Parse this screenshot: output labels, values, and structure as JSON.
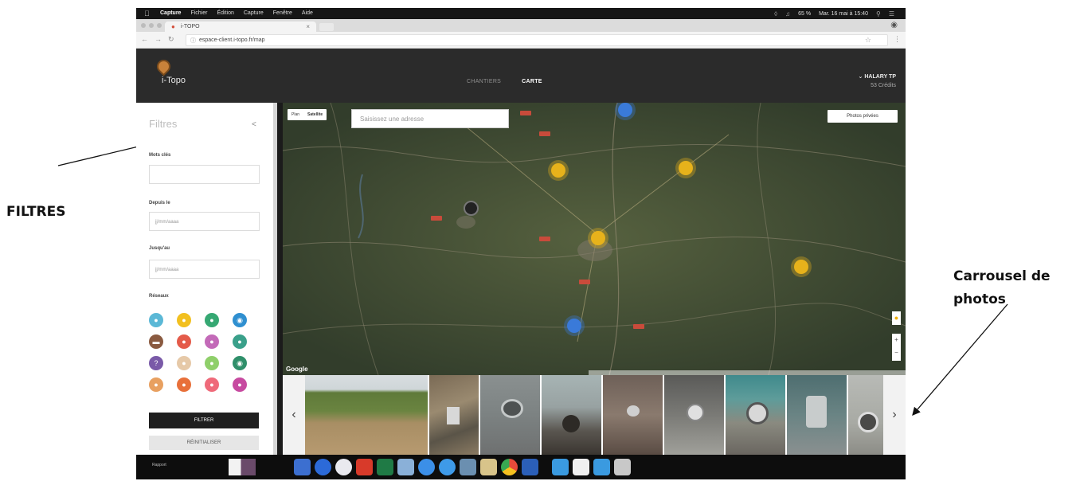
{
  "annotations": {
    "filters_label": "FILTRES",
    "carousel_label_line1": "Carrousel de",
    "carousel_label_line2": "photos"
  },
  "menubar": {
    "app_name": "Capture",
    "menus": [
      "Fichier",
      "Édition",
      "Capture",
      "Fenêtre",
      "Aide"
    ],
    "battery": "65 %",
    "datetime": "Mar. 16 mai à 15:40"
  },
  "browser": {
    "tab_title": "i-TOPO",
    "url": "espace-client.i-topo.fr/map"
  },
  "app": {
    "logo_text": "i-Topo",
    "nav": {
      "chantiers": "CHANTIERS",
      "carte": "CARTE"
    },
    "user": {
      "name": "HALARY TP",
      "credits": "53 Crédits"
    }
  },
  "sidebar": {
    "title": "Filtres",
    "collapse": "<",
    "keywords_label": "Mots clés",
    "keywords_value": "",
    "since_label": "Depuis le",
    "since_placeholder": "jj/mm/aaaa",
    "until_label": "Jusqu'au",
    "until_placeholder": "jj/mm/aaaa",
    "networks_label": "Réseaux",
    "filter_button": "FILTRER",
    "reset_button": "RÉINITIALISER",
    "network_colors": [
      "#5bb8d6",
      "#f2c020",
      "#36a873",
      "#2f8fd0",
      "#8a5a40",
      "#e45b4a",
      "#c36ab8",
      "#3aa08a",
      "#7a5aa8",
      "#e6c9a8",
      "#8fcf6a",
      "#2f8f6a",
      "#e8a060",
      "#e8703a",
      "#ef6a7a",
      "#c74aa0"
    ],
    "network_icons": [
      "droplet-icon",
      "sun-icon",
      "leaf-icon",
      "eye-icon",
      "cable-icon",
      "flame-icon",
      "fiber-icon",
      "water-icon",
      "question-icon",
      "gas-icon",
      "telecom-icon",
      "sewer-icon",
      "heat-icon",
      "electric-icon",
      "light-icon",
      "signal-icon"
    ]
  },
  "map": {
    "map_type_plan": "Plan",
    "map_type_satellite": "Satellite",
    "search_placeholder": "Saisissez une adresse",
    "private_photos_button": "Photos privées",
    "google_mark": "Google",
    "zoom_in": "+",
    "zoom_out": "−"
  },
  "carousel": {
    "prev": "‹",
    "next": "›",
    "photo_count": 10
  },
  "dock": {
    "label": "Rapport"
  }
}
